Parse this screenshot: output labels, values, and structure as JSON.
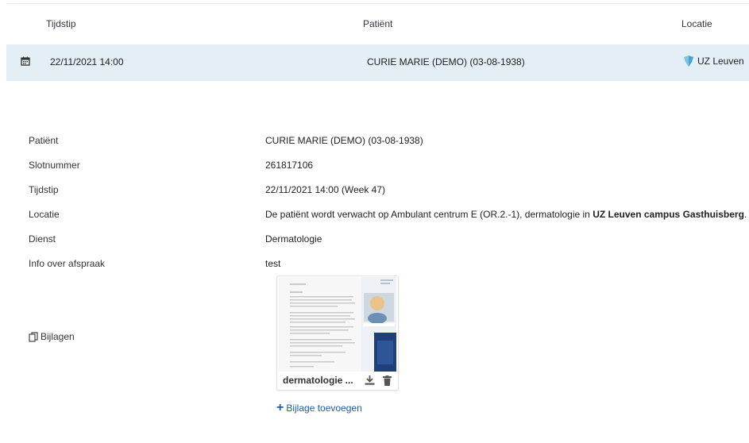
{
  "table": {
    "headers": {
      "tijdstip": "Tijdstip",
      "patient": "Patiënt",
      "locatie": "Locatie"
    },
    "row": {
      "date": "22/11/2021 14:00",
      "patient": "CURIE MARIE (DEMO) (03-08-1938)",
      "location": "UZ Leuven",
      "icon": "calendar-icon"
    }
  },
  "details": {
    "fields": [
      {
        "label": "Patiënt",
        "value": "CURIE MARIE (DEMO) (03-08-1938)"
      },
      {
        "label": "Slotnummer",
        "value": "261817106"
      },
      {
        "label": "Tijdstip",
        "value": "22/11/2021 14:00 (Week 47)"
      },
      {
        "label": "Locatie",
        "value_prefix": "De patiënt wordt verwacht op Ambulant centrum E (OR.2.-1), dermatologie in ",
        "value_bold": "UZ Leuven campus Gasthuisberg",
        "value_suffix": "."
      },
      {
        "label": "Dienst",
        "value": "Dermatologie"
      },
      {
        "label": "Info over afspraak",
        "value": "test"
      }
    ],
    "attachments": {
      "label": "Bijlagen",
      "file_name": "dermatologie ...",
      "add_label": "Bijlage toevoegen"
    }
  },
  "colors": {
    "row_highlight": "#e3eef5",
    "link": "#1e5ba8"
  }
}
